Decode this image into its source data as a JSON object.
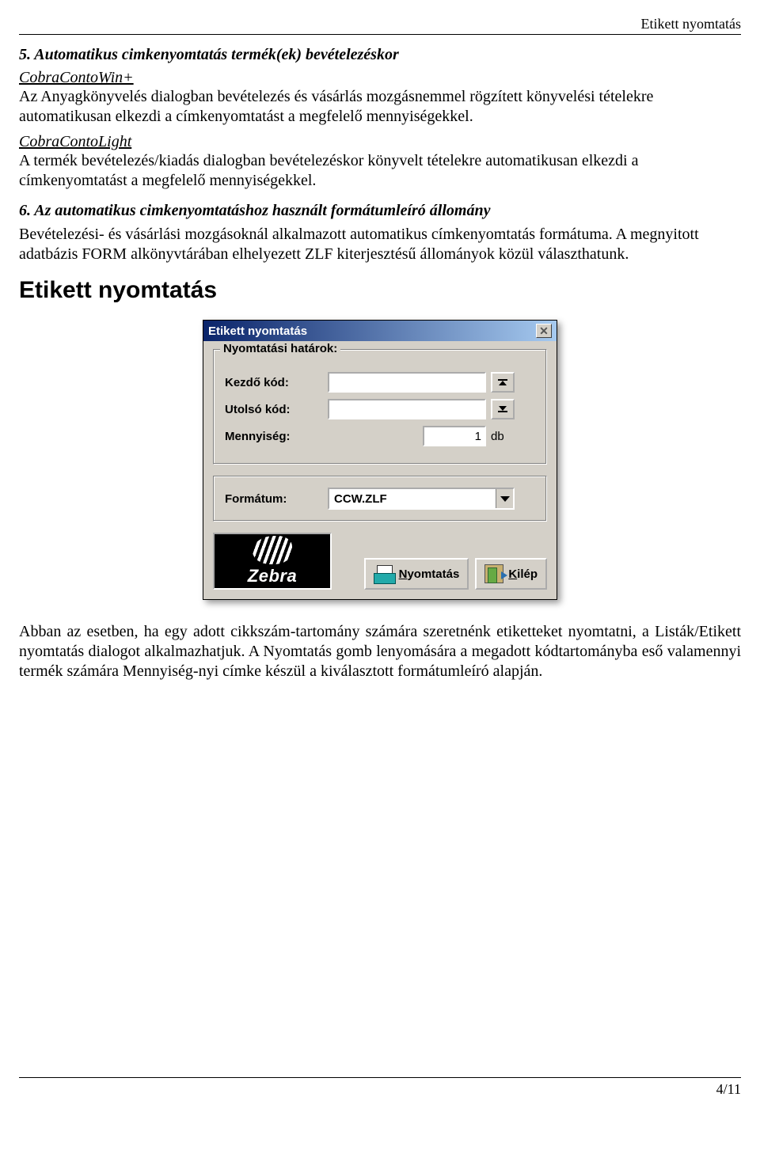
{
  "running_header": "Etikett nyomtatás",
  "sections": {
    "s5_title": "5. Automatikus cimkenyomtatás termék(ek) bevételezéskor",
    "link1": "CobraContoWin+",
    "p1": "Az Anyagkönyvelés dialogban bevételezés és vásárlás mozgásnemmel rögzített könyvelési tételekre automatikusan elkezdi a címkenyomtatást a megfelelő mennyiségekkel.",
    "link2": "CobraContoLight",
    "p2": "A termék bevételezés/kiadás dialogban bevételezéskor könyvelt tételekre automatikusan elkezdi a címkenyomtatást a megfelelő mennyiségekkel.",
    "s6_title": "6. Az automatikus cimkenyomtatáshoz használt formátumleíró állomány",
    "p3": "Bevételezési- és vásárlási mozgásoknál alkalmazott automatikus címkenyomtatás formátuma. A megnyitott adatbázis FORM alkönyvtárában elhelyezett ZLF kiterjesztésű állományok közül választhatunk.",
    "h1": "Etikett nyomtatás",
    "p4": "Abban az esetben, ha egy adott cikkszám-tartomány számára szeretnénk etiketteket nyomtatni, a Listák/Etikett nyomtatás dialogot alkalmazhatjuk. A Nyomtatás gomb lenyomására a megadott kódtartományba eső valamennyi termék számára Mennyiség-nyi címke készül a kiválasztott formátumleíró alapján."
  },
  "dialog": {
    "title": "Etikett nyomtatás",
    "group1_legend": "Nyomtatási határok:",
    "label_start": "Kezdő kód:",
    "value_start": "",
    "label_end": "Utolsó kód:",
    "value_end": "",
    "label_qty": "Mennyiség:",
    "value_qty": "1",
    "unit_qty": "db",
    "label_format": "Formátum:",
    "value_format": "CCW.ZLF",
    "btn_print": "Nyomtatás",
    "btn_print_u": "N",
    "btn_exit": "Kilép",
    "btn_exit_u": "K",
    "logo_text": "Zebra"
  },
  "page_number": "4/11"
}
